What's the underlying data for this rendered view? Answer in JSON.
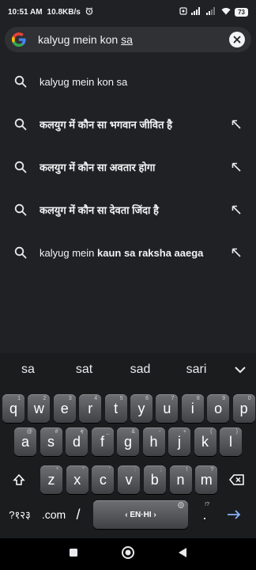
{
  "status": {
    "time": "10:51 AM",
    "speed": "10.8KB/s",
    "battery": "73"
  },
  "search": {
    "query_prefix": "kalyug mein kon ",
    "query_underlined": "sa"
  },
  "suggestions": [
    {
      "normal": "kalyug mein kon sa",
      "bold": "",
      "has_arrow": false
    },
    {
      "normal": "",
      "bold": "कलयुग में कौन सा भगवान जीवित है",
      "has_arrow": true
    },
    {
      "normal": "",
      "bold": "कलयुग में कौन सा अवतार होगा",
      "has_arrow": true
    },
    {
      "normal": "",
      "bold": "कलयुग में कौन सा देवता जिंदा है",
      "has_arrow": true
    },
    {
      "normal": "kalyug mein ",
      "bold": "kaun sa raksha aaega",
      "has_arrow": true
    }
  ],
  "keyboard": {
    "predictions": [
      "sa",
      "sat",
      "sad",
      "sari"
    ],
    "row1": [
      [
        "q",
        "1"
      ],
      [
        "w",
        "2"
      ],
      [
        "e",
        "3"
      ],
      [
        "r",
        "4"
      ],
      [
        "t",
        "5"
      ],
      [
        "y",
        "6"
      ],
      [
        "u",
        "7"
      ],
      [
        "i",
        "8"
      ],
      [
        "o",
        "9"
      ],
      [
        "p",
        "0"
      ]
    ],
    "row2": [
      [
        "a",
        "@"
      ],
      [
        "s",
        "#"
      ],
      [
        "d",
        "₹"
      ],
      [
        "f",
        "_"
      ],
      [
        "g",
        "&"
      ],
      [
        "h",
        "-"
      ],
      [
        "j",
        "+"
      ],
      [
        "k",
        "("
      ],
      [
        "l",
        ")"
      ]
    ],
    "row3": [
      [
        "z",
        "*"
      ],
      [
        "x",
        "\""
      ],
      [
        "c",
        "'"
      ],
      [
        "v",
        ":"
      ],
      [
        "b",
        ";"
      ],
      [
        "n",
        "!"
      ],
      [
        "m",
        "?"
      ]
    ],
    "symbols_label": "?१२३",
    "com_label": ".com",
    "slash_label": "/",
    "space_label": "‹ EN·HI ›",
    "period_label": ".",
    "period_sup": "!?"
  },
  "colors": {
    "background": "#1f2124",
    "search_bg": "#303134",
    "enter_arrow": "#8ab4f8"
  }
}
